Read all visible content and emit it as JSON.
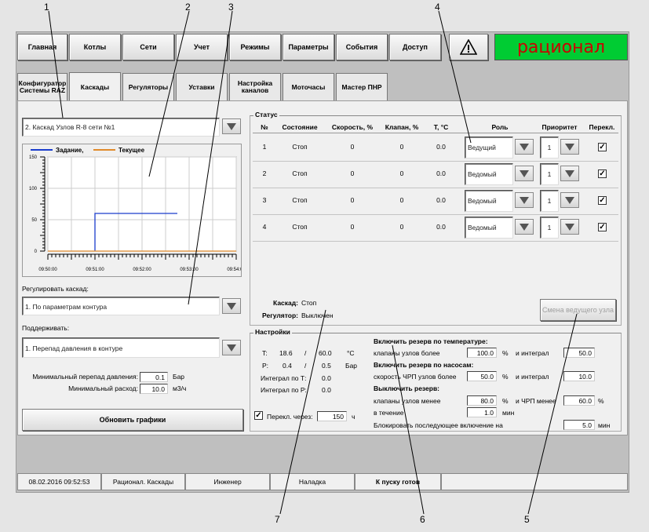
{
  "top_nav": [
    "Главная",
    "Котлы",
    "Сети",
    "Учет",
    "Режимы",
    "Параметры",
    "События",
    "Доступ"
  ],
  "brand": "рационал",
  "brand_color": "#00cc33",
  "warning_icon": "warning-triangle-icon",
  "tabs": [
    {
      "label": "Конфигуратор Системы RAZ"
    },
    {
      "label": "Каскады",
      "active": true
    },
    {
      "label": "Регуляторы"
    },
    {
      "label": "Уставки"
    },
    {
      "label": "Настройка каналов"
    },
    {
      "label": "Моточасы"
    },
    {
      "label": "Мастер ПНР"
    }
  ],
  "left": {
    "cascade_select": "2. Каскад Узлов R-8 сети №1",
    "legend_setpoint": "Задание,",
    "legend_current": "Текущее",
    "regulate_label": "Регулировать каскад:",
    "regulate_select": "1. По параметрам контура",
    "maintain_label": "Поддерживать:",
    "maintain_select": "1. Перепад давления в контуре",
    "min_dp_label": "Минимальный перепад давления:",
    "min_dp_value": "0.1",
    "min_dp_unit": "Бар",
    "min_flow_label": "Минимальный расход:",
    "min_flow_value": "10.0",
    "min_flow_unit": "м3/ч",
    "update_button": "Обновить графики"
  },
  "chart_data": {
    "type": "line",
    "x": [
      "09:50:00",
      "09:51:00",
      "09:52:00",
      "09:53:00",
      "09:54:00"
    ],
    "yticks": [
      0,
      50,
      100,
      150
    ],
    "ylim": [
      0,
      150
    ],
    "series": [
      {
        "name": "Задание,",
        "color": "#1a3ccc",
        "points": [
          [
            "09:51:00",
            0
          ],
          [
            "09:51:00",
            60
          ],
          [
            "09:52:45",
            60
          ]
        ]
      },
      {
        "name": "Текущее",
        "color": "#e08a2a",
        "points": [
          [
            "09:50:00",
            0
          ],
          [
            "09:54:00",
            0
          ]
        ]
      }
    ]
  },
  "status": {
    "title": "Статус",
    "headers": [
      "№",
      "Состояние",
      "Скорость, %",
      "Клапан, %",
      "Т, °С",
      "Роль",
      "Приоритет",
      "Перекл."
    ],
    "rows": [
      {
        "n": "1",
        "state": "Стоп",
        "speed": "0",
        "valve": "0",
        "temp": "0.0",
        "role": "Ведущий",
        "priority": "1",
        "check": "✓"
      },
      {
        "n": "2",
        "state": "Стоп",
        "speed": "0",
        "valve": "0",
        "temp": "0.0",
        "role": "Ведомый",
        "priority": "1",
        "check": "✓"
      },
      {
        "n": "3",
        "state": "Стоп",
        "speed": "0",
        "valve": "0",
        "temp": "0.0",
        "role": "Ведомый",
        "priority": "1",
        "check": "✓"
      },
      {
        "n": "4",
        "state": "Стоп",
        "speed": "0",
        "valve": "0",
        "temp": "0.0",
        "role": "Ведомый",
        "priority": "1",
        "check": "✓"
      }
    ],
    "cascade_label": "Каскад:",
    "cascade_value": "Стоп",
    "regulator_label": "Регулятор:",
    "regulator_value": "Выключен",
    "change_master_button": "Смена ведущего узла"
  },
  "settings": {
    "title": "Настройки",
    "t_label": "T:",
    "t_value": "18.6",
    "t_slash": "/",
    "t_set": "60.0",
    "t_unit": "°C",
    "p_label": "P:",
    "p_value": "0.4",
    "p_slash": "/",
    "p_set": "0.5",
    "p_unit": "Бар",
    "int_t_label": "Интеграл по Т:",
    "int_t_value": "0.0",
    "int_p_label": "Интеграл по Р:",
    "int_p_value": "0.0",
    "switch_check": "✓",
    "switch_label": "Перекл. через:",
    "switch_value": "150",
    "switch_unit": "ч",
    "reserve_temp_title": "Включить резерв по температуре:",
    "valves_above_label": "клапаны узлов более",
    "valves_above_value": "100.0",
    "pct1": "%",
    "integral_label1": "и интеграл",
    "integral_value1": "50.0",
    "reserve_pump_title": "Включить резерв по насосам:",
    "vfd_above_label": "скорость ЧРП узлов более",
    "vfd_above_value": "50.0",
    "pct2": "%",
    "integral_label2": "и интеграл",
    "integral_value2": "10.0",
    "reserve_off_title": "Выключить резерв:",
    "valves_below_label": "клапаны узлов менее",
    "valves_below_value": "80.0",
    "pct3": "%",
    "vfd_below_label": "и ЧРП менее",
    "vfd_below_value": "60.0",
    "pct4": "%",
    "during_label": "в течение",
    "during_value": "1.0",
    "during_unit": "мин",
    "block_label": "Блокировать последующее включение на",
    "block_value": "5.0",
    "block_unit": "мин"
  },
  "statusbar": [
    "08.02.2016 09:52:53",
    "Рационал. Каскады",
    "Инженер",
    "Наладка",
    "К пуску готов"
  ],
  "callouts": [
    "1",
    "2",
    "3",
    "4",
    "5",
    "6",
    "7"
  ]
}
